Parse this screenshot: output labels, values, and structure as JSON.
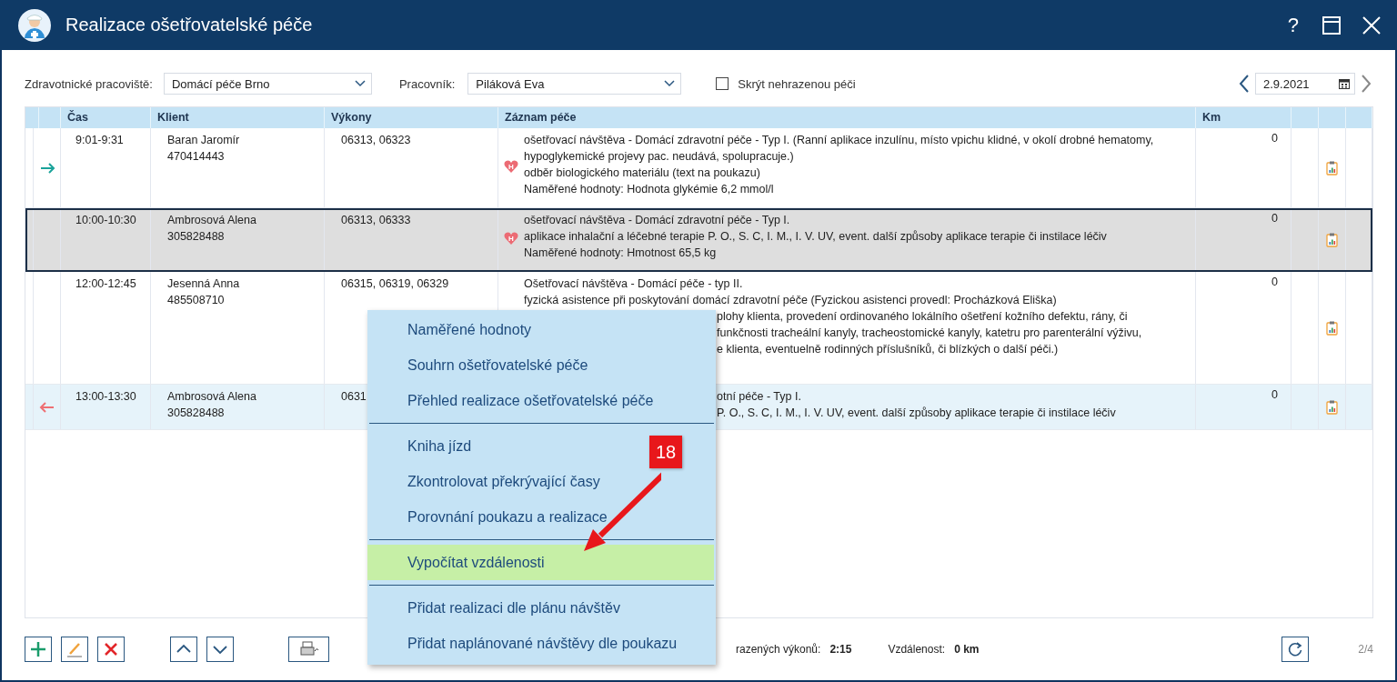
{
  "window": {
    "title": "Realizace ošetřovatelské péče",
    "buttons": [
      "?"
    ]
  },
  "filters": {
    "workplace_label": "Zdravotnické pracoviště:",
    "workplace_value": "Domácí péče Brno",
    "worker_label": "Pracovník:",
    "worker_value": "Piláková Eva",
    "hide_unpaid": {
      "label": "Skrýt nehrazenou péči",
      "checked": false
    },
    "date": "2.9.2021"
  },
  "table": {
    "columns": [
      "Čas",
      "Klient",
      "Výkony",
      "Záznam péče",
      "Km"
    ],
    "rows": [
      {
        "kind": "incoming",
        "selected": false,
        "shaded": false,
        "time": "9:01-9:31",
        "client": "Baran Jaromír",
        "client_id": "470414443",
        "codes": "06313, 06323",
        "badge": "H",
        "km": "0",
        "report": true,
        "record": [
          {
            "kind": "full",
            "text": "ošetřovací návštěva - Domácí zdravotní péče - Typ I. (Ranní aplikace inzulínu, místo vpichu klidné, v okolí drobné hematomy,"
          },
          {
            "kind": "full",
            "text": "hypoglykemické projevy pac. neudává, spolupracuje.)"
          },
          {
            "kind": "full",
            "text": "odběr biologického materiálu (text na poukazu)"
          },
          {
            "kind": "full",
            "text": "Naměřené hodnoty: Hodnota glykémie 6,2 mmol/l"
          }
        ]
      },
      {
        "kind": "plain",
        "selected": true,
        "shaded": false,
        "time": "10:00-10:30",
        "client": "Ambrosová Alena",
        "client_id": "305828488",
        "codes": "06313, 06333",
        "badge": "H",
        "km": "0",
        "report": true,
        "record": [
          {
            "kind": "full",
            "text": "ošetřovací návštěva - Domácí zdravotní péče - Typ I."
          },
          {
            "kind": "full",
            "text": "aplikace inhalační a léčebné terapie P. O., S. C, I. M., I. V. UV, event. další způsoby aplikace terapie či instilace léčiv"
          },
          {
            "kind": "full",
            "text": "Naměřené hodnoty: Hmotnost 65,5 kg"
          }
        ]
      },
      {
        "kind": "plain",
        "selected": false,
        "shaded": false,
        "time": "12:00-12:45",
        "client": "Jesenná Anna",
        "client_id": "485508710",
        "codes": "06315, 06319, 06329",
        "km": "0",
        "report": true,
        "record": [
          {
            "kind": "full",
            "text": "Ošetřovací návštěva - Domácí péče - typ II."
          },
          {
            "kind": "full",
            "text": "fyzická asistence při poskytování domácí zdravotní péče (Fyzickou asistenci provedl: Procházková Eliška)"
          },
          {
            "kind": "partial",
            "text": "plohy klienta, provedení ordinovaného lokálního ošetření kožního defektu, rány, či"
          },
          {
            "kind": "partial",
            "text": "funkčnosti tracheální kanyly, tracheostomické kanyly, katetru pro parenterální výživu,"
          },
          {
            "kind": "partial",
            "text": "e klienta, eventuelně rodinných příslušníků, či blízkých o další péči.)"
          }
        ]
      },
      {
        "kind": "outgoing",
        "selected": false,
        "shaded": true,
        "time": "13:00-13:30",
        "client": "Ambrosová Alena",
        "client_id": "305828488",
        "codes": "0631",
        "km": "0",
        "report": true,
        "record": [
          {
            "kind": "partial",
            "text": "otní péče - Typ I."
          },
          {
            "kind": "partial",
            "text": "P. O., S. C, I. M., I. V. UV, event. další způsoby aplikace terapie či instilace léčiv"
          }
        ]
      }
    ]
  },
  "toolbar": {
    "status": [
      {
        "label": "razených výkonů:",
        "value": "2:15"
      },
      {
        "label": "Vzdálenost:",
        "value": "0 km"
      }
    ],
    "page": "2/4"
  },
  "context_menu": {
    "groups": [
      [
        {
          "label": "Naměřené hodnoty",
          "selected": false
        },
        {
          "label": "Souhrn ošetřovatelské péče",
          "selected": false
        },
        {
          "label": "Přehled realizace ošetřovatelské péče",
          "selected": false
        }
      ],
      [
        {
          "label": "Kniha jízd",
          "selected": false
        },
        {
          "label": "Zkontrolovat překrývající časy",
          "selected": false
        },
        {
          "label": "Porovnání poukazu a realizace",
          "selected": false
        }
      ],
      [
        {
          "label": "Vypočítat vzdálenosti",
          "selected": true
        }
      ],
      [
        {
          "label": "Přidat realizaci dle plánu návštěv",
          "selected": false
        },
        {
          "label": "Přidat naplánované návštěvy dle poukazu",
          "selected": false
        }
      ]
    ]
  },
  "callout": {
    "number": "18"
  }
}
